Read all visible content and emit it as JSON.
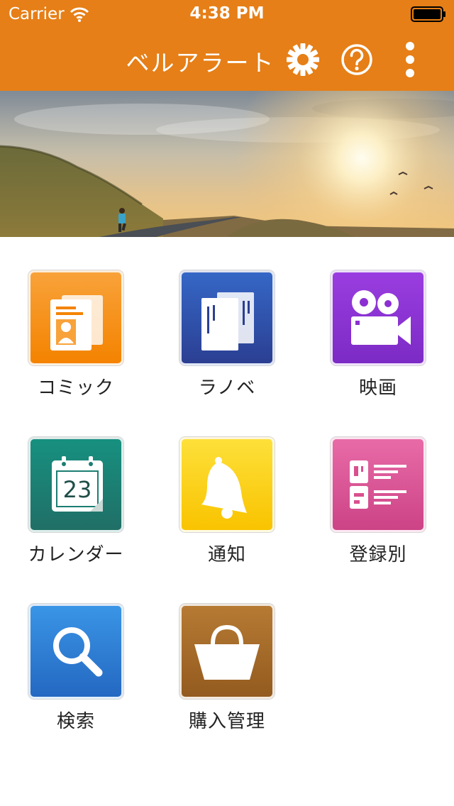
{
  "status_bar": {
    "carrier": "Carrier",
    "time": "4:38 PM"
  },
  "nav": {
    "title": "ベルアラート",
    "buttons": [
      "gear-icon",
      "help-icon",
      "more-vertical-icon"
    ]
  },
  "colors": {
    "header": "#e67f17",
    "comic": "#f7931e",
    "lightnovel": "#2b3f92",
    "movie": "#8b2fd2",
    "calendar": "#1b7e72",
    "notification": "#fbc712",
    "by_registration": "#d9508f",
    "search": "#2a7fd4",
    "purchase": "#a46b2a"
  },
  "menu": {
    "comic": {
      "label": "コミック",
      "icon": "id-cards-icon"
    },
    "lightnovel": {
      "label": "ラノベ",
      "icon": "books-icon"
    },
    "movie": {
      "label": "映画",
      "icon": "movie-camera-icon"
    },
    "calendar": {
      "label": "カレンダー",
      "icon": "calendar-icon",
      "day": "23"
    },
    "notification": {
      "label": "通知",
      "icon": "bell-icon"
    },
    "by_registration": {
      "label": "登録別",
      "icon": "list-icon"
    },
    "search": {
      "label": "検索",
      "icon": "magnifier-icon"
    },
    "purchase": {
      "label": "購入管理",
      "icon": "basket-icon"
    }
  }
}
